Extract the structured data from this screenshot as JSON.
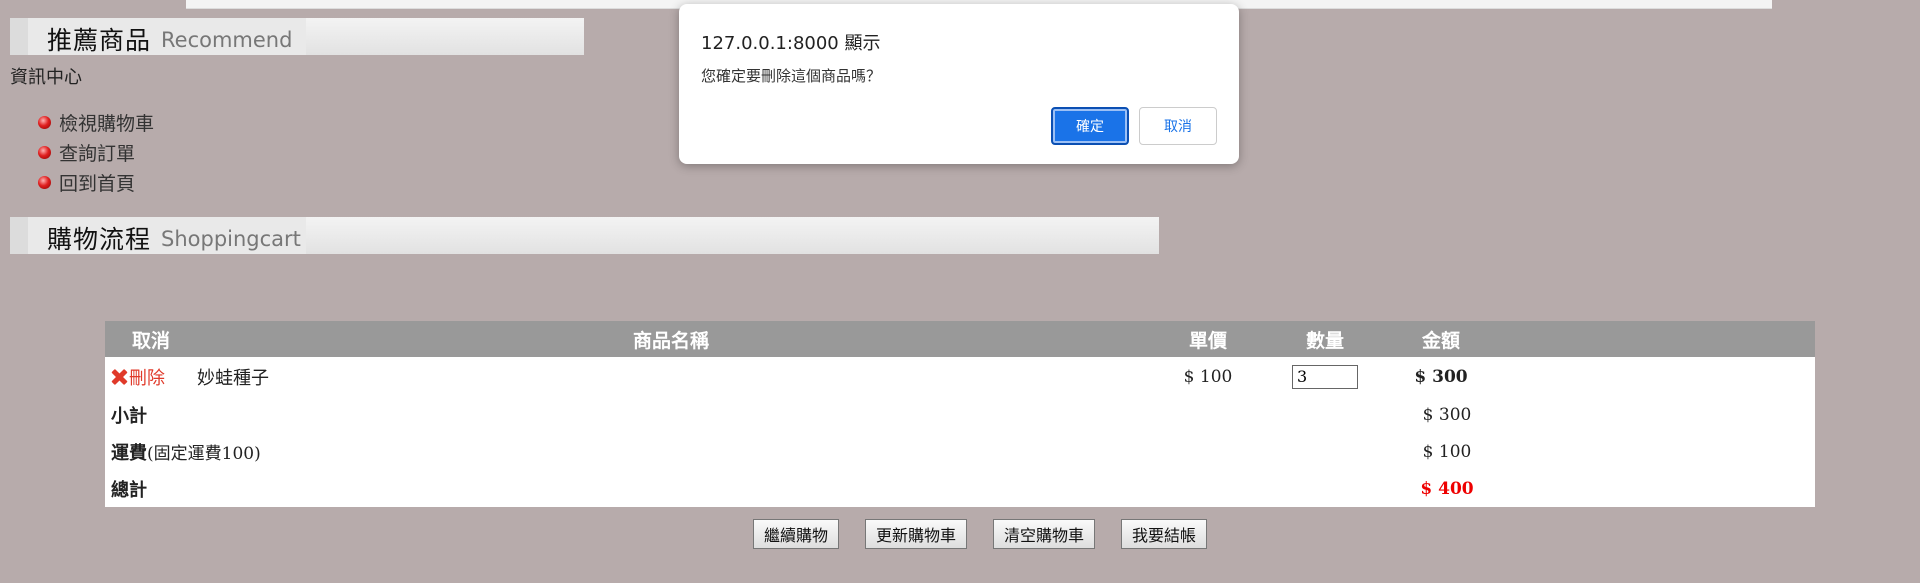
{
  "recommend": {
    "title_zh": "推薦商品",
    "title_en": "Recommend"
  },
  "info_center": {
    "title": "資訊中心",
    "items": [
      {
        "label": "檢視購物車"
      },
      {
        "label": "查詢訂單"
      },
      {
        "label": "回到首頁"
      }
    ]
  },
  "shopping": {
    "title_zh": "購物流程",
    "title_en": "Shoppingcart"
  },
  "cart": {
    "headers": {
      "cancel": "取消",
      "name": "商品名稱",
      "price": "單價",
      "qty": "數量",
      "amount": "金額"
    },
    "item": {
      "delete_label": "刪除",
      "name": "妙蛙種子",
      "price": "$ 100",
      "qty": "3",
      "amount": "$ 300"
    },
    "subtotal": {
      "label": "小計",
      "value": "$ 300"
    },
    "shipping": {
      "label": "運費",
      "note": "(固定運費100)",
      "value": "$ 100"
    },
    "total": {
      "label": "總計",
      "value": "$ 400",
      "color": "#ee0000"
    }
  },
  "buttons": {
    "continue": "繼續購物",
    "update": "更新購物車",
    "clear": "清空購物車",
    "checkout": "我要結帳"
  },
  "dialog": {
    "title": "127.0.0.1:8000 顯示",
    "message": "您確定要刪除這個商品嗎？",
    "ok": "確定",
    "cancel": "取消"
  }
}
